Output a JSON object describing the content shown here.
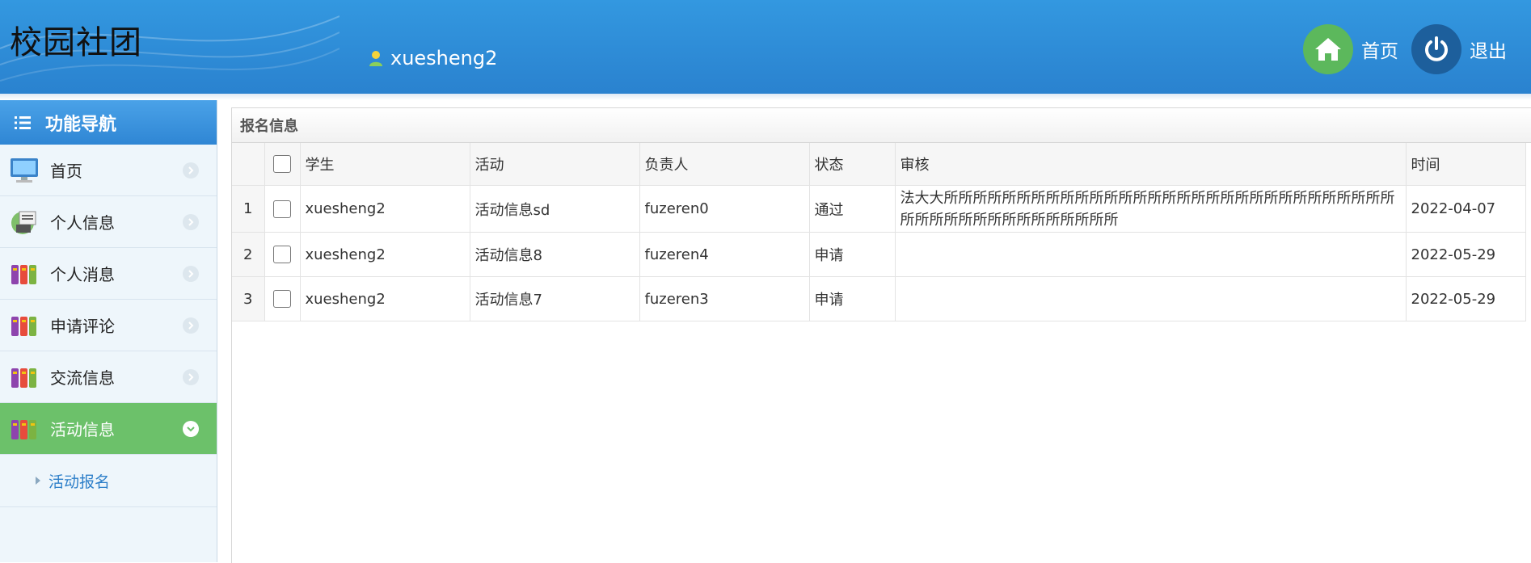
{
  "header": {
    "app_title": "校园社团",
    "username": "xuesheng2",
    "home_label": "首页",
    "logout_label": "退出"
  },
  "sidebar": {
    "title": "功能导航",
    "items": [
      {
        "label": "首页",
        "icon": "monitor-icon"
      },
      {
        "label": "个人信息",
        "icon": "id-card-icon"
      },
      {
        "label": "个人消息",
        "icon": "books-icon"
      },
      {
        "label": "申请评论",
        "icon": "books-icon"
      },
      {
        "label": "交流信息",
        "icon": "books-icon"
      },
      {
        "label": "活动信息",
        "icon": "books-icon",
        "active": true
      }
    ],
    "sub_items": [
      {
        "label": "活动报名"
      }
    ]
  },
  "panel": {
    "title": "报名信息",
    "columns": [
      "学生",
      "活动",
      "负责人",
      "状态",
      "审核",
      "时间"
    ],
    "rows": [
      {
        "no": "1",
        "student": "xuesheng2",
        "activity": "活动信息sd",
        "owner": "fuzeren0",
        "status": "通过",
        "review": "法大大所所所所所所所所所所所所所所所所所所所所所所所所所所所所所所所所所所所所所所所所所所所所所所",
        "time": "2022-04-07"
      },
      {
        "no": "2",
        "student": "xuesheng2",
        "activity": "活动信息8",
        "owner": "fuzeren4",
        "status": "申请",
        "review": "",
        "time": "2022-05-29"
      },
      {
        "no": "3",
        "student": "xuesheng2",
        "activity": "活动信息7",
        "owner": "fuzeren3",
        "status": "申请",
        "review": "",
        "time": "2022-05-29"
      }
    ]
  },
  "colors": {
    "header_blue": "#2a82cf",
    "active_green": "#6cc16a",
    "home_green": "#5cb85c",
    "link_blue": "#2d7fc9"
  }
}
